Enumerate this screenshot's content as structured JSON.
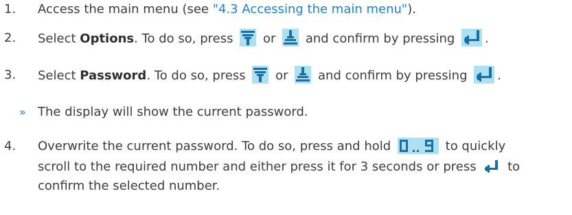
{
  "steps": [
    {
      "num": "1.",
      "pre": "Access the main menu (see ",
      "link": "\"4.3 Accessing the main menu\"",
      "post": ")."
    },
    {
      "num": "2.",
      "pre": "Select ",
      "bold": "Options",
      "mid": ". To do so, press ",
      "or": "or",
      "confirm": "and confirm by pressing",
      "end": "."
    },
    {
      "num": "3.",
      "pre": "Select ",
      "bold": "Password",
      "mid": ". To do so, press ",
      "or": "or",
      "confirm": "and confirm by pressing",
      "end": "."
    },
    {
      "num": "»",
      "text": "The display will show the current password."
    },
    {
      "num": "4.",
      "pre": "Overwrite the current password. To do so, press and hold",
      "post": "to quickly",
      "line2a": "scroll to the required number and either press it for 3 seconds or press",
      "line2b": "to",
      "line3": "confirm the selected number."
    }
  ],
  "icons": {
    "down": "arrow-down-icon",
    "up": "arrow-up-icon",
    "enter": "enter-icon",
    "digits": "digits-0-9-icon"
  },
  "colors": {
    "link": "#1f7fd0",
    "icon_bg": "#aee0f4",
    "icon_fg": "#1a6ea8",
    "digit_fg": "#1a6ea8"
  }
}
